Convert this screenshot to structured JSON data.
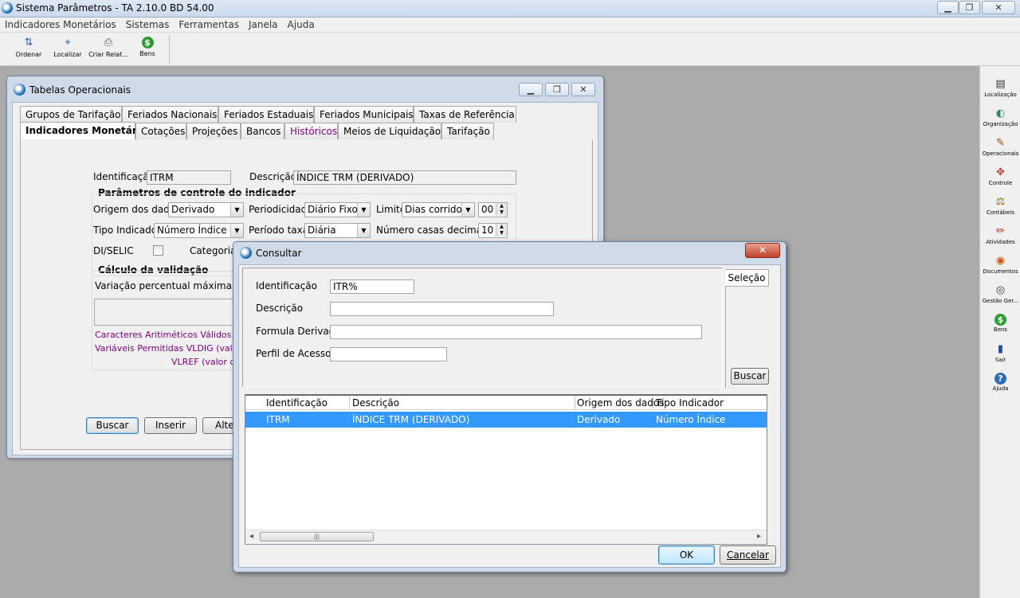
{
  "app": {
    "title": "Sistema Parâmetros -  TA 2.10.0 BD 54.00",
    "minimize": "▁",
    "restore": "❐",
    "close": "✕"
  },
  "menu": [
    "Indicadores Monetários",
    "Sistemas",
    "Ferramentas",
    "Janela",
    "Ajuda"
  ],
  "toolbar": [
    {
      "label": "Ordenar",
      "icon": "sort-icon",
      "glyph": "⇅"
    },
    {
      "label": "Localizar",
      "icon": "find-icon",
      "glyph": "⌖"
    },
    {
      "label": "Criar Relat...",
      "icon": "print-icon",
      "glyph": "⎙"
    },
    {
      "label": "Bens",
      "icon": "money-bag-icon",
      "glyph": "$"
    }
  ],
  "sidebar": [
    {
      "label": "Localização",
      "icon": "location-icon",
      "glyph": "▤"
    },
    {
      "label": "Organização",
      "icon": "organization-icon",
      "glyph": "◐"
    },
    {
      "label": "Operacionais",
      "icon": "operational-icon",
      "glyph": "✎"
    },
    {
      "label": "Controle",
      "icon": "control-icon",
      "glyph": "✥"
    },
    {
      "label": "Contábeis",
      "icon": "scales-icon",
      "glyph": "⚖"
    },
    {
      "label": "Atividades",
      "icon": "pin-icon",
      "glyph": "✏"
    },
    {
      "label": "Documentos",
      "icon": "documents-icon",
      "glyph": "◉"
    },
    {
      "label": "Gestão Ger...",
      "icon": "eye-icon",
      "glyph": "◎"
    },
    {
      "label": "Bens",
      "icon": "money-bag-icon",
      "glyph": "$"
    },
    {
      "label": "Sair",
      "icon": "exit-icon",
      "glyph": "▮"
    },
    {
      "label": "Ajuda",
      "icon": "help-icon",
      "glyph": "?"
    }
  ],
  "tabelas": {
    "title": "Tabelas Operacionais",
    "tabs_row1": [
      "Grupos de Tarifação",
      "Feriados Nacionais",
      "Feriados Estaduais",
      "Feriados Municipais",
      "Taxas de Referência"
    ],
    "tabs_row2": [
      "Indicadores Monetários",
      "Cotações",
      "Projeções",
      "Bancos",
      "Históricos",
      "Meios de Liquidação",
      "Tarifação"
    ],
    "identificacao_label": "Identificação",
    "identificacao_value": "ITRM",
    "descricao_label": "Descrição",
    "descricao_value": "ÍNDICE TRM (DERIVADO)",
    "group_params": "Parâmetros de controle do indicador",
    "origem_label": "Origem dos dados",
    "origem_value": "Derivado",
    "periodicidade_label": "Periodicidade",
    "periodicidade_value": "Diário Fixo",
    "limite_label": "Limite",
    "limite_value": "Dias corridos",
    "limite_num": "00",
    "tipo_label": "Tipo Indicador",
    "tipo_value": "Número Índice",
    "periodo_label": "Período taxa",
    "periodo_value": "Diária",
    "casas_label": "Número casas decimais",
    "casas_value": "10",
    "diselic_label": "DI/SELIC",
    "categoria_label": "Categoria R",
    "group_calc": "Cálculo da validação",
    "variacao_label": "Variação percentual máxima permitid",
    "caracteres_text": "Caracteres Aritiméticos Válidos:   ( )",
    "variaveis_text": "Variáveis Permitidas VLDIG  (valor infe",
    "vlref_text": "VLREF (valor da",
    "buttons": [
      "Buscar",
      "Inserir",
      "Alter"
    ],
    "spin_up": "▲",
    "spin_down": "▼",
    "combo_arrow": "▼"
  },
  "consultar": {
    "title": "Consultar",
    "close": "✕",
    "identificacao_label": "Identificação",
    "identificacao_value": "ITR%",
    "descricao_label": "Descrição",
    "descricao_value": "",
    "formula_label": "Formula Derivada",
    "formula_value": "",
    "perfil_label": "Perfil de Acesso",
    "perfil_value": "",
    "selecao_label": "Seleção",
    "buscar_label": "Buscar",
    "columns": [
      "Identificação",
      "Descrição",
      "Origem dos dados",
      "Tipo Indicador"
    ],
    "rows": [
      [
        "ITRM",
        "ÍNDICE TRM (DERIVADO)",
        "Derivado",
        "Número Índice"
      ]
    ],
    "scroll_left": "◂",
    "scroll_right": "▸",
    "scroll_grip": "|||",
    "ok_label": "OK",
    "cancelar_label": "Cancelar"
  }
}
